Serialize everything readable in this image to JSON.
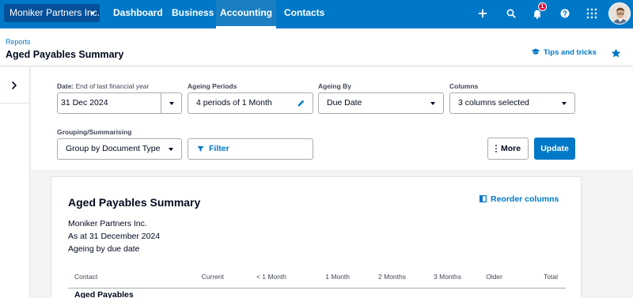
{
  "nav": {
    "org_name": "Moniker Partners Inc.",
    "links": [
      "Dashboard",
      "Business",
      "Accounting",
      "Contacts"
    ],
    "active_link": "Accounting",
    "notification_count": "1",
    "icons": [
      "plus-icon",
      "search-icon",
      "bell-icon",
      "help-icon",
      "apps-icon"
    ]
  },
  "header": {
    "breadcrumb": "Reports",
    "title": "Aged Payables Summary",
    "tips_label": "Tips and tricks"
  },
  "settings": {
    "date": {
      "label": "Date:",
      "hint": "End of last financial year",
      "value": "31 Dec 2024"
    },
    "ageing_periods": {
      "label": "Ageing Periods",
      "value": "4 periods of 1 Month"
    },
    "ageing_by": {
      "label": "Ageing By",
      "value": "Due Date"
    },
    "columns": {
      "label": "Columns",
      "value": "3 columns selected"
    },
    "grouping": {
      "label": "Grouping/Summarising",
      "value": "Group by Document Type"
    },
    "filter_label": "Filter",
    "more_label": "More",
    "update_label": "Update"
  },
  "report": {
    "title": "Aged Payables Summary",
    "reorder_label": "Reorder columns",
    "company": "Moniker Partners Inc.",
    "as_at": "As at 31 December 2024",
    "ageing_basis": "Ageing by due date",
    "columns": [
      "Contact",
      "Current",
      "< 1 Month",
      "1 Month",
      "2 Months",
      "3 Months",
      "Older",
      "Total"
    ],
    "section": "Aged Payables"
  },
  "colors": {
    "nav_bg": "#0078c8",
    "org_bg": "#06509a",
    "accent": "#0078c8",
    "badge": "#de0e40",
    "page_bg": "#f2f3f4"
  }
}
